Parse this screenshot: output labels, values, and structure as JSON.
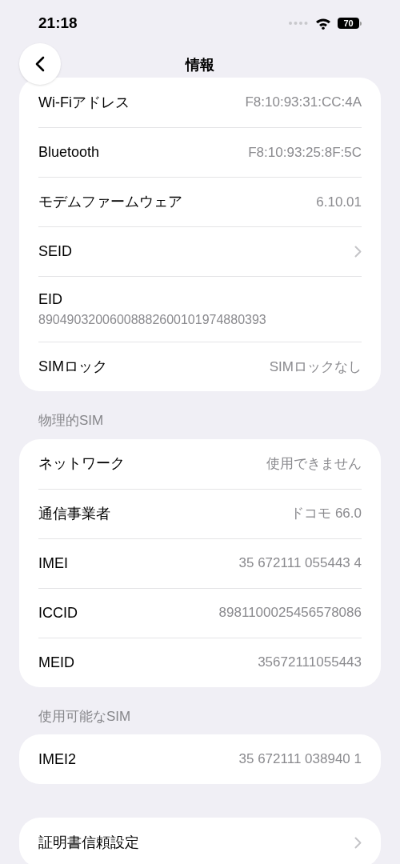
{
  "status_bar": {
    "time": "21:18",
    "battery": "70"
  },
  "nav": {
    "title": "情報"
  },
  "sections": [
    {
      "rows": [
        {
          "kind": "value",
          "label": "Wi-Fiアドレス",
          "value": "F8:10:93:31:CC:4A"
        },
        {
          "kind": "value",
          "label": "Bluetooth",
          "value": "F8:10:93:25:8F:5C"
        },
        {
          "kind": "value",
          "label": "モデムファームウェア",
          "value": "6.10.01"
        },
        {
          "kind": "chevron",
          "label": "SEID"
        },
        {
          "kind": "stacked",
          "label": "EID",
          "value": "89049032006008882600101974880393"
        },
        {
          "kind": "value",
          "label": "SIMロック",
          "value": "SIMロックなし"
        }
      ]
    },
    {
      "header": "物理的SIM",
      "rows": [
        {
          "kind": "value",
          "label": "ネットワーク",
          "value": "使用できません"
        },
        {
          "kind": "value",
          "label": "通信事業者",
          "value": "ドコモ 66.0"
        },
        {
          "kind": "value",
          "label": "IMEI",
          "value": "35 672111 055443 4"
        },
        {
          "kind": "value",
          "label": "ICCID",
          "value": "8981100025456578086"
        },
        {
          "kind": "value",
          "label": "MEID",
          "value": "35672111055443"
        }
      ]
    },
    {
      "header": "使用可能なSIM",
      "rows": [
        {
          "kind": "value",
          "label": "IMEI2",
          "value": "35 672111 038940 1"
        }
      ]
    },
    {
      "rows": [
        {
          "kind": "chevron",
          "label": "証明書信頼設定"
        }
      ]
    }
  ]
}
